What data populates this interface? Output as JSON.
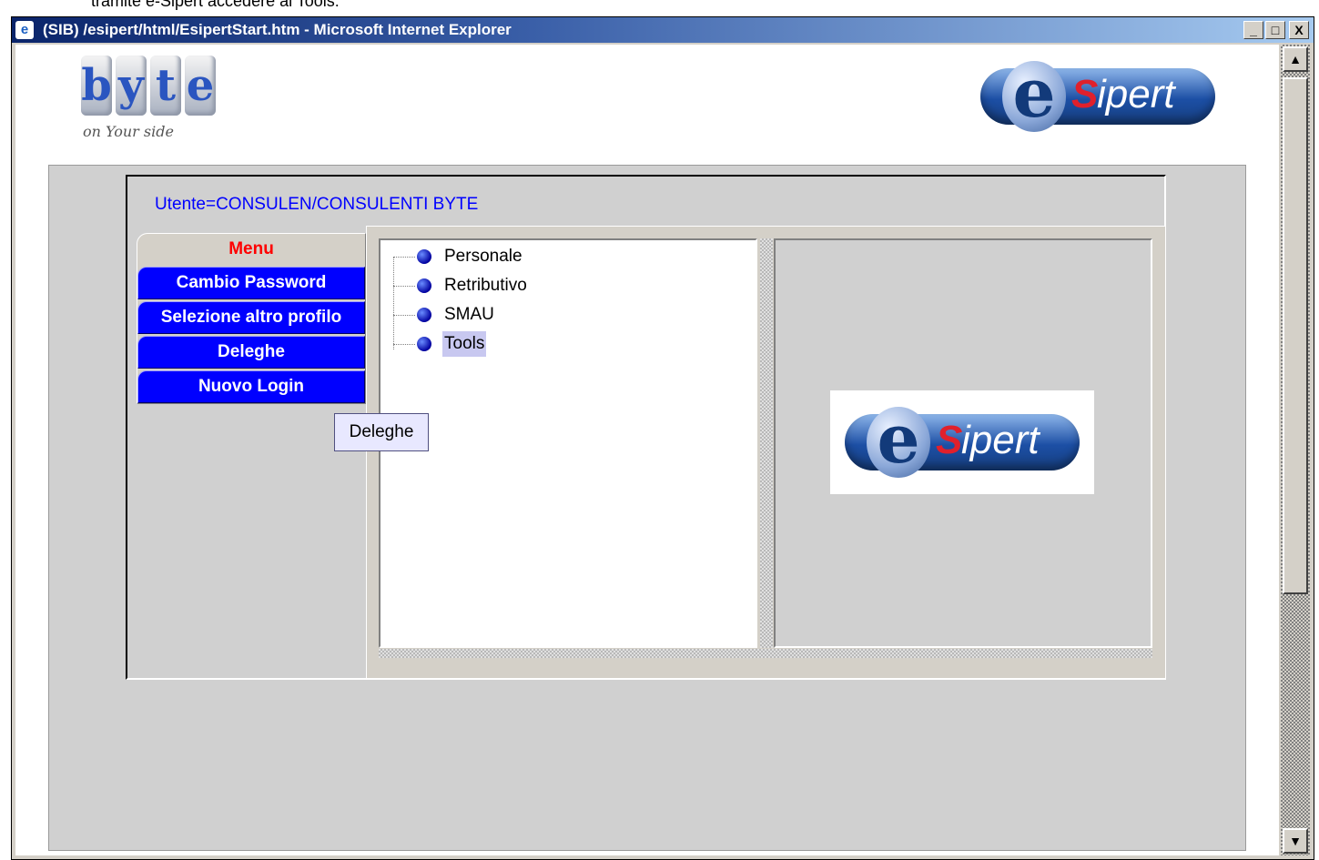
{
  "document": {
    "caption": "tramite e-Sipert accedere al Tools:"
  },
  "window": {
    "title": "(SIB) /esipert/html/EsipertStart.htm - Microsoft Internet Explorer",
    "minimize_label": "_",
    "maximize_label": "□",
    "close_label": "X"
  },
  "scrollbar": {
    "up_arrow": "▲",
    "down_arrow": "▼"
  },
  "logos": {
    "byte_letters": [
      "b",
      "y",
      "t",
      "e"
    ],
    "byte_tagline": "on Your side",
    "esipert_e": "e",
    "esipert_s": "S",
    "esipert_rest": "ipert"
  },
  "user": {
    "label": "Utente=CONSULEN/CONSULENTI BYTE"
  },
  "menu": {
    "title": "Menu",
    "items": [
      {
        "label": "Cambio Password"
      },
      {
        "label": "Selezione altro profilo"
      },
      {
        "label": "Deleghe"
      },
      {
        "label": "Nuovo Login"
      }
    ]
  },
  "tree": {
    "items": [
      {
        "label": "Personale",
        "selected": false
      },
      {
        "label": "Retributivo",
        "selected": false
      },
      {
        "label": "SMAU",
        "selected": false
      },
      {
        "label": "Tools",
        "selected": true
      }
    ]
  },
  "tooltip": {
    "text": "Deleghe"
  },
  "colors": {
    "menu_button": "#0000ff",
    "menu_title": "#ff0000",
    "user_label": "#0000ff",
    "panel_gray": "#d0d0d0"
  }
}
